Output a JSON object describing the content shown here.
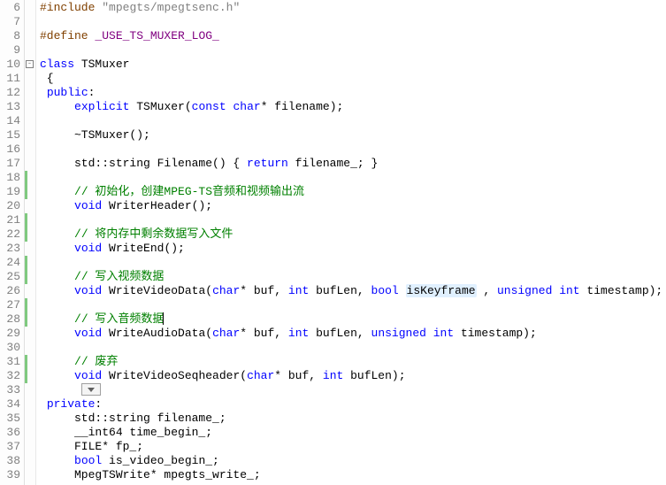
{
  "chart_data": null,
  "colors": {
    "keyword": "#0000ff",
    "preprocessor": "#804000",
    "string": "#808080",
    "macro": "#800080",
    "comment": "#008000",
    "change_bar": "#7fc97f",
    "line_number": "#808080",
    "highlight": "#e0f0ff"
  },
  "lines": [
    {
      "num": 6,
      "changed": false,
      "fold": null,
      "tokens": [
        [
          "pp",
          "#include"
        ],
        [
          "",
          " "
        ],
        [
          "str",
          "\"mpegts/mpegtsenc.h\""
        ]
      ]
    },
    {
      "num": 7,
      "changed": false,
      "fold": null,
      "tokens": []
    },
    {
      "num": 8,
      "changed": false,
      "fold": null,
      "tokens": [
        [
          "pp",
          "#define"
        ],
        [
          "",
          " "
        ],
        [
          "mac",
          "_USE_TS_MUXER_LOG_"
        ]
      ]
    },
    {
      "num": 9,
      "changed": false,
      "fold": null,
      "tokens": []
    },
    {
      "num": 10,
      "changed": false,
      "fold": "open",
      "tokens": [
        [
          "kw",
          "class"
        ],
        [
          "",
          " TSMuxer"
        ]
      ]
    },
    {
      "num": 11,
      "changed": false,
      "fold": null,
      "tokens": [
        [
          "",
          " {"
        ]
      ]
    },
    {
      "num": 12,
      "changed": false,
      "fold": null,
      "tokens": [
        [
          "",
          " "
        ],
        [
          "kw",
          "public"
        ],
        [
          "",
          ":"
        ]
      ]
    },
    {
      "num": 13,
      "changed": false,
      "fold": null,
      "tokens": [
        [
          "",
          "     "
        ],
        [
          "kw",
          "explicit"
        ],
        [
          "",
          " TSMuxer("
        ],
        [
          "kw",
          "const"
        ],
        [
          "",
          " "
        ],
        [
          "kw",
          "char"
        ],
        [
          "",
          "* filename);"
        ]
      ]
    },
    {
      "num": 14,
      "changed": false,
      "fold": null,
      "tokens": []
    },
    {
      "num": 15,
      "changed": false,
      "fold": null,
      "tokens": [
        [
          "",
          "     ~TSMuxer();"
        ]
      ]
    },
    {
      "num": 16,
      "changed": false,
      "fold": null,
      "tokens": []
    },
    {
      "num": 17,
      "changed": false,
      "fold": null,
      "tokens": [
        [
          "",
          "     std::string Filename() { "
        ],
        [
          "kw",
          "return"
        ],
        [
          "",
          " filename_; }"
        ]
      ]
    },
    {
      "num": 18,
      "changed": true,
      "fold": null,
      "tokens": []
    },
    {
      "num": 19,
      "changed": true,
      "fold": null,
      "tokens": [
        [
          "",
          "     "
        ],
        [
          "cmt",
          "// 初始化，创建MPEG-TS音频和视频输出流"
        ]
      ]
    },
    {
      "num": 20,
      "changed": false,
      "fold": null,
      "tokens": [
        [
          "",
          "     "
        ],
        [
          "kw",
          "void"
        ],
        [
          "",
          " WriterHeader();"
        ]
      ]
    },
    {
      "num": 21,
      "changed": true,
      "fold": null,
      "tokens": []
    },
    {
      "num": 22,
      "changed": true,
      "fold": null,
      "tokens": [
        [
          "",
          "     "
        ],
        [
          "cmt",
          "// 将内存中剩余数据写入文件"
        ]
      ]
    },
    {
      "num": 23,
      "changed": false,
      "fold": null,
      "tokens": [
        [
          "",
          "     "
        ],
        [
          "kw",
          "void"
        ],
        [
          "",
          " WriteEnd();"
        ]
      ]
    },
    {
      "num": 24,
      "changed": true,
      "fold": null,
      "tokens": []
    },
    {
      "num": 25,
      "changed": true,
      "fold": null,
      "tokens": [
        [
          "",
          "     "
        ],
        [
          "cmt",
          "// 写入视频数据"
        ]
      ]
    },
    {
      "num": 26,
      "changed": false,
      "fold": null,
      "tokens": [
        [
          "",
          "     "
        ],
        [
          "kw",
          "void"
        ],
        [
          "",
          " WriteVideoData("
        ],
        [
          "kw",
          "char"
        ],
        [
          "",
          "* buf, "
        ],
        [
          "kw",
          "int"
        ],
        [
          "",
          " bufLen, "
        ],
        [
          "kw",
          "bool"
        ],
        [
          "",
          " "
        ],
        [
          "hl",
          "isKeyframe"
        ],
        [
          "",
          " , "
        ],
        [
          "kw",
          "unsigned"
        ],
        [
          "",
          " "
        ],
        [
          "kw",
          "int"
        ],
        [
          "",
          " timestamp);"
        ]
      ]
    },
    {
      "num": 27,
      "changed": true,
      "fold": null,
      "tokens": []
    },
    {
      "num": 28,
      "changed": true,
      "fold": null,
      "cursor": true,
      "tokens": [
        [
          "",
          "     "
        ],
        [
          "cmt",
          "// 写入音频数据"
        ]
      ]
    },
    {
      "num": 29,
      "changed": false,
      "fold": null,
      "tokens": [
        [
          "",
          "     "
        ],
        [
          "kw",
          "void"
        ],
        [
          "",
          " WriteAudioData("
        ],
        [
          "kw",
          "char"
        ],
        [
          "",
          "* buf, "
        ],
        [
          "kw",
          "int"
        ],
        [
          "",
          " bufLen, "
        ],
        [
          "kw",
          "unsigned"
        ],
        [
          "",
          " "
        ],
        [
          "kw",
          "int"
        ],
        [
          "",
          " timestamp);"
        ]
      ]
    },
    {
      "num": 30,
      "changed": false,
      "fold": null,
      "tokens": []
    },
    {
      "num": 31,
      "changed": true,
      "fold": null,
      "tokens": [
        [
          "",
          "     "
        ],
        [
          "cmt",
          "// 废弃"
        ]
      ]
    },
    {
      "num": 32,
      "changed": true,
      "fold": null,
      "tokens": [
        [
          "",
          "     "
        ],
        [
          "kw",
          "void"
        ],
        [
          "",
          " WriteVideoSeqheader("
        ],
        [
          "kw",
          "char"
        ],
        [
          "",
          "* buf, "
        ],
        [
          "kw",
          "int"
        ],
        [
          "",
          " bufLen);"
        ]
      ]
    },
    {
      "num": 33,
      "changed": false,
      "fold": null,
      "expand": true,
      "tokens": [
        [
          "",
          "      "
        ]
      ]
    },
    {
      "num": 34,
      "changed": false,
      "fold": null,
      "tokens": [
        [
          "",
          " "
        ],
        [
          "kw",
          "private"
        ],
        [
          "",
          ":"
        ]
      ]
    },
    {
      "num": 35,
      "changed": false,
      "fold": null,
      "tokens": [
        [
          "",
          "     std::string filename_;"
        ]
      ]
    },
    {
      "num": 36,
      "changed": false,
      "fold": null,
      "tokens": [
        [
          "",
          "     __int64 time_begin_;"
        ]
      ]
    },
    {
      "num": 37,
      "changed": false,
      "fold": null,
      "tokens": [
        [
          "",
          "     FILE* fp_;"
        ]
      ]
    },
    {
      "num": 38,
      "changed": false,
      "fold": null,
      "tokens": [
        [
          "",
          "     "
        ],
        [
          "kw",
          "bool"
        ],
        [
          "",
          " is_video_begin_;"
        ]
      ]
    },
    {
      "num": 39,
      "changed": false,
      "fold": null,
      "tokens": [
        [
          "",
          "     MpegTSWrite* mpegts_write_;"
        ]
      ]
    }
  ]
}
